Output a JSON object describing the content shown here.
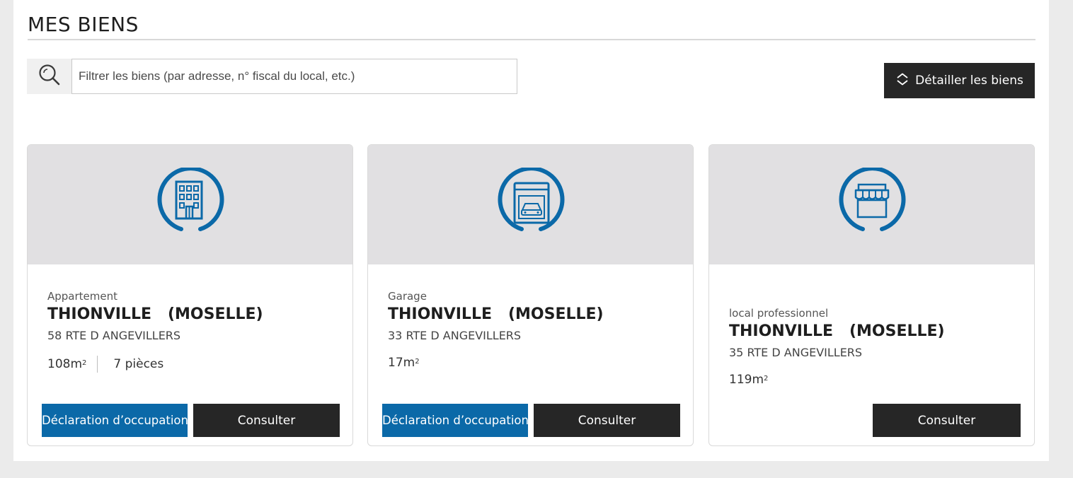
{
  "page": {
    "title": "MES BIENS"
  },
  "search": {
    "placeholder": "Filtrer les biens (par adresse, n° fiscal du local, etc.)",
    "value": ""
  },
  "detail_button": {
    "label": "Détailler les biens"
  },
  "colors": {
    "accent": "#0b69a8",
    "dark_button": "#262626",
    "card_header": "#e1e0e2"
  },
  "cards": [
    {
      "icon": "apartment-building-icon",
      "type": "Appartement",
      "city": "THIONVILLE   (MOSELLE)",
      "address": "58 RTE D ANGEVILLERS",
      "surface": "108m",
      "surface_exp": "2",
      "rooms": "7 pièces",
      "declaration_label": "Déclaration d’occupation",
      "consult_label": "Consulter"
    },
    {
      "icon": "garage-car-icon",
      "type": "Garage",
      "city": "THIONVILLE   (MOSELLE)",
      "address": "33 RTE D ANGEVILLERS",
      "surface": "17m",
      "surface_exp": "2",
      "declaration_label": "Déclaration d’occupation",
      "consult_label": "Consulter"
    },
    {
      "icon": "shop-storefront-icon",
      "type": "local professionnel",
      "city": "THIONVILLE   (MOSELLE)",
      "address": "35 RTE D ANGEVILLERS",
      "surface": "119m",
      "surface_exp": "2",
      "consult_label": "Consulter"
    }
  ]
}
